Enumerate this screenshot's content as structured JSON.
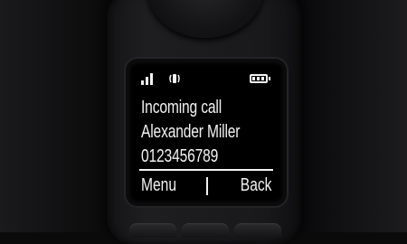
{
  "status": {
    "signal_icon": "signal-bars-icon",
    "ringer_icon": "vibrate-ringer-icon",
    "battery_icon": "battery-full-icon"
  },
  "call": {
    "status_text": "Incoming call",
    "caller_name": "Alexander Miller",
    "caller_number": "0123456789"
  },
  "softkeys": {
    "left_label": "Menu",
    "right_label": "Back"
  },
  "colors": {
    "screen_background": "#000000",
    "screen_text": "#f2f2f2",
    "handset_body": "#1a1a1c"
  }
}
